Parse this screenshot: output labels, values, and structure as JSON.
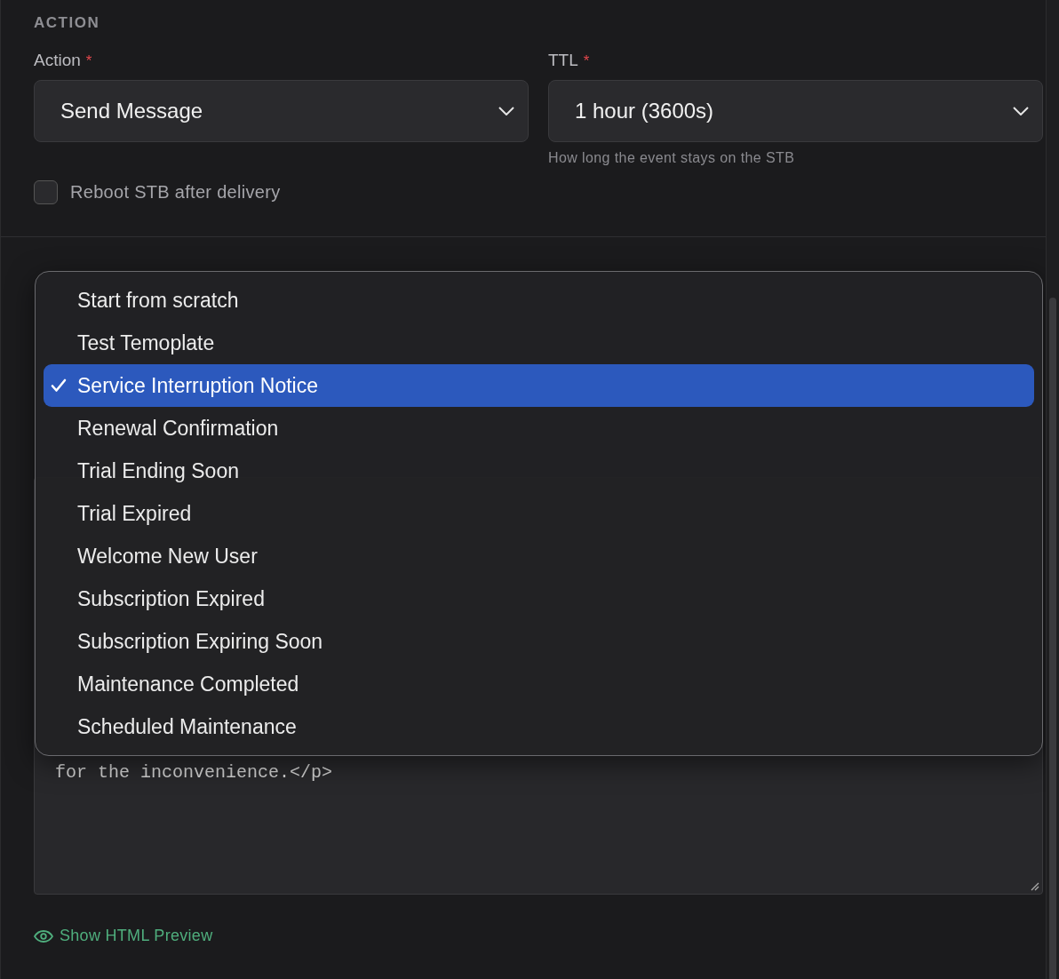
{
  "section_title": "ACTION",
  "fields": [
    {
      "label": "Action",
      "required_mark": "*",
      "value": "Send Message"
    },
    {
      "label": "TTL",
      "required_mark": "*",
      "value": "1 hour (3600s)",
      "hint": "How long the event stays on the STB"
    }
  ],
  "reboot": {
    "label": "Reboot STB after delivery",
    "checked": false
  },
  "editor": {
    "visible_text": "for the inconvenience.</p>"
  },
  "template_menu": {
    "items": [
      {
        "label": "Start from scratch",
        "selected": false
      },
      {
        "label": "Test Temoplate",
        "selected": false
      },
      {
        "label": "Service Interruption Notice",
        "selected": true
      },
      {
        "label": "Renewal Confirmation",
        "selected": false
      },
      {
        "label": "Trial Ending Soon",
        "selected": false
      },
      {
        "label": "Trial Expired",
        "selected": false
      },
      {
        "label": "Welcome New User",
        "selected": false
      },
      {
        "label": "Subscription Expired",
        "selected": false
      },
      {
        "label": "Subscription Expiring Soon",
        "selected": false
      },
      {
        "label": "Maintenance Completed",
        "selected": false
      },
      {
        "label": "Scheduled Maintenance",
        "selected": false
      }
    ]
  },
  "preview_link": "Show HTML Preview"
}
